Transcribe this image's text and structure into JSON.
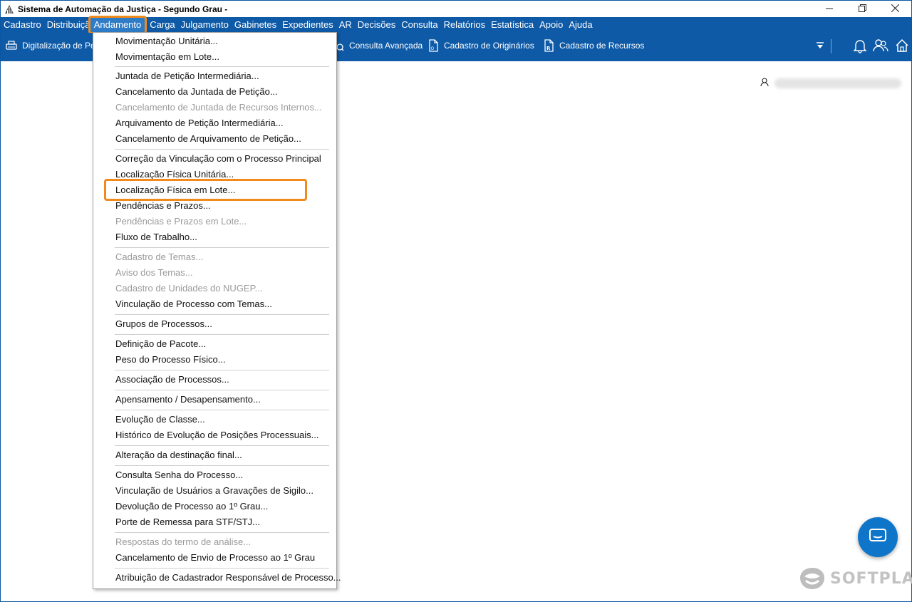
{
  "window": {
    "title": "Sistema de Automação da Justiça - Segundo Grau -",
    "controls": [
      "minimize",
      "restore",
      "close"
    ]
  },
  "menubar": {
    "items": [
      "Cadastro",
      "Distribuição",
      "Andamento",
      "Carga",
      "Julgamento",
      "Gabinetes",
      "Expedientes",
      "AR",
      "Decisões",
      "Consulta",
      "Relatórios",
      "Estatística",
      "Apoio",
      "Ajuda"
    ],
    "active": "Andamento"
  },
  "toolbar": {
    "digitalizacao": "Digitalização de Pe",
    "consulta_avancada": "Consulta Avançada",
    "cadastro_originarios": "Cadastro de Originários",
    "cadastro_recursos": "Cadastro de Recursos"
  },
  "dropdown": {
    "items": [
      {
        "label": "Movimentação Unitária...",
        "disabled": false
      },
      {
        "label": "Movimentação em Lote...",
        "disabled": false
      },
      {
        "label": "Juntada de Petição Intermediária...",
        "disabled": false
      },
      {
        "label": "Cancelamento da Juntada de Petição...",
        "disabled": false
      },
      {
        "label": "Cancelamento de Juntada de Recursos Internos...",
        "disabled": true
      },
      {
        "label": "Arquivamento de Petição Intermediária...",
        "disabled": false
      },
      {
        "label": "Cancelamento de Arquivamento de Petição...",
        "disabled": false
      },
      {
        "label": "Correção da Vinculação com o Processo Principal",
        "disabled": false
      },
      {
        "label": "Localização Física Unitária...",
        "disabled": false
      },
      {
        "label": "Localização Física em Lote...",
        "disabled": false
      },
      {
        "label": "Pendências e Prazos...",
        "disabled": false
      },
      {
        "label": "Pendências e Prazos em Lote...",
        "disabled": true
      },
      {
        "label": "Fluxo de Trabalho...",
        "disabled": false
      },
      {
        "label": "Cadastro de Temas...",
        "disabled": true
      },
      {
        "label": "Aviso dos Temas...",
        "disabled": true
      },
      {
        "label": "Cadastro de Unidades do NUGEP...",
        "disabled": true
      },
      {
        "label": "Vinculação de Processo com Temas...",
        "disabled": false
      },
      {
        "label": "Grupos de Processos...",
        "disabled": false
      },
      {
        "label": "Definição de Pacote...",
        "disabled": false
      },
      {
        "label": "Peso do Processo Físico...",
        "disabled": false
      },
      {
        "label": "Associação de Processos...",
        "disabled": false
      },
      {
        "label": "Apensamento / Desapensamento...",
        "disabled": false
      },
      {
        "label": "Evolução de Classe...",
        "disabled": false
      },
      {
        "label": "Histórico de Evolução de Posições Processuais...",
        "disabled": false
      },
      {
        "label": "Alteração da destinação final...",
        "disabled": false
      },
      {
        "label": "Consulta Senha do Processo...",
        "disabled": false
      },
      {
        "label": "Vinculação de Usuários a Gravações de Sigilo...",
        "disabled": false
      },
      {
        "label": "Devolução de Processo ao 1º Grau...",
        "disabled": false
      },
      {
        "label": "Porte de Remessa para STF/STJ...",
        "disabled": false
      },
      {
        "label": "Respostas do termo de análise...",
        "disabled": true
      },
      {
        "label": "Cancelamento de Envio de Processo ao 1º Grau",
        "disabled": false
      },
      {
        "label": "Atribuição de Cadastrador Responsável de Processo...",
        "disabled": false
      }
    ],
    "highlighted": "Localização Física em Lote..."
  },
  "user": {
    "name": ""
  },
  "brand": {
    "logo": "SOFTPLAN"
  },
  "colors": {
    "accent": "#0e5aa7",
    "highlight": "#f08a1c",
    "chat": "#0f75c8"
  },
  "icons": [
    "app-icon",
    "scanner-icon",
    "search-doc-icon",
    "document-icon",
    "document-r-icon",
    "dropdown-arrow-icon",
    "bell-icon",
    "users-icon",
    "home-icon",
    "user-icon",
    "chat-icon"
  ]
}
